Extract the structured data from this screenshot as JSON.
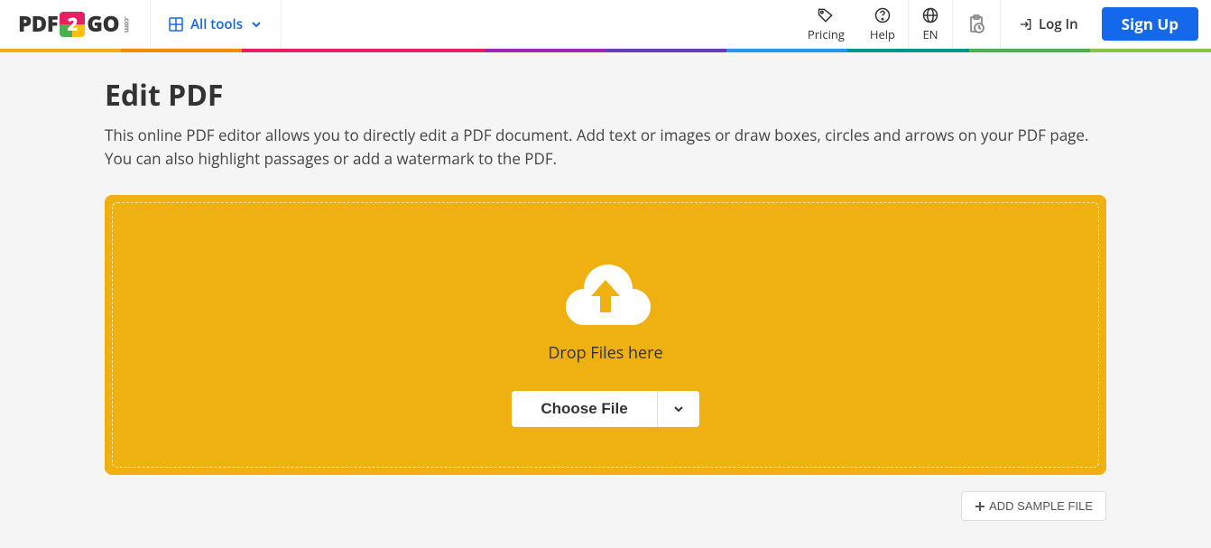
{
  "header": {
    "logo_pdf": "PDF",
    "logo_go": "GO",
    "logo_dotcom": ".com",
    "all_tools": "All tools",
    "pricing": "Pricing",
    "help": "Help",
    "language": "EN",
    "login": "Log In",
    "signup": "Sign Up"
  },
  "rainbow_colors": [
    "#eeb111",
    "#f28c00",
    "#e91e63",
    "#e91e63",
    "#9c27b0",
    "#673ab7",
    "#2196f3",
    "#009688",
    "#4caf50",
    "#8bc34a"
  ],
  "page": {
    "title": "Edit PDF",
    "subtitle": "This online PDF editor allows you to directly edit a PDF document. Add text or images or draw boxes, circles and arrows on your PDF page. You can also highlight passages or add a watermark to the PDF."
  },
  "dropzone": {
    "drop_text": "Drop Files here",
    "choose_file": "Choose File"
  },
  "sample": {
    "label": "ADD SAMPLE FILE"
  }
}
